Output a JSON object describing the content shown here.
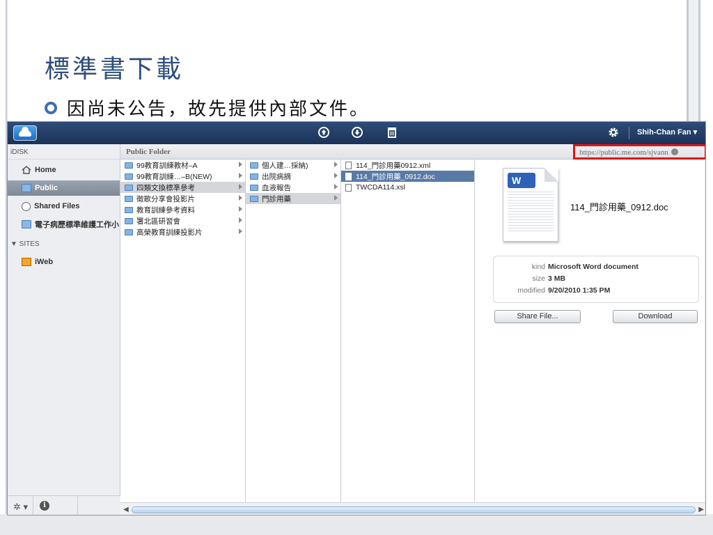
{
  "slide": {
    "title": "標準書下載",
    "bullet": "因尚未公告，故先提供內部文件。"
  },
  "topbar": {
    "upload_icon": "upload-icon",
    "download_icon": "download-icon",
    "trash_icon": "trash-icon",
    "settings_icon": "gear-icon",
    "user_label": "Shih-Chan Fan ▾"
  },
  "sidebar": {
    "idisk_header": "iDISK",
    "items": [
      {
        "label": "Home",
        "icon": "home-icon"
      },
      {
        "label": "Public",
        "icon": "folder-icon"
      },
      {
        "label": "Shared Files",
        "icon": "shared-icon"
      },
      {
        "label": "電子病歷標準維護工作小",
        "icon": "folder-icon"
      }
    ],
    "sites_header": "▼ SITES",
    "sites": [
      {
        "label": "iWeb",
        "icon": "iweb-icon"
      }
    ]
  },
  "path_bar": {
    "title": "Public Folder",
    "url": "https://public.me.com/sjvann"
  },
  "columns": {
    "col1": [
      "99教育訓練教材–A",
      "99教育訓練…–B(NEW)",
      "四類文換標準參考",
      "徵歌分享會投影片",
      "教育訓練參考資料",
      "署北區研習會",
      "高榮教育訓練投影片"
    ],
    "col2": [
      "個人建…採納)",
      "出院病摘",
      "血液報告",
      "門診用藥"
    ],
    "col3": [
      "114_門診用藥0912.xml",
      "114_門診用藥_0912.doc",
      "TWCDA114.xsl"
    ]
  },
  "preview": {
    "filename": "114_門診用藥_0912.doc",
    "badge": "W",
    "kind_label": "kind",
    "kind_value": "Microsoft Word document",
    "size_label": "size",
    "size_value": "3 MB",
    "modified_label": "modified",
    "modified_value": "9/20/2010 1:35 PM",
    "share_button": "Share File...",
    "download_button": "Download"
  },
  "footer": {
    "gear_label": "✲ ▾",
    "info_label": "i"
  },
  "scrollbar": {
    "left_arrow": "◀",
    "right_arrow": "▶"
  }
}
